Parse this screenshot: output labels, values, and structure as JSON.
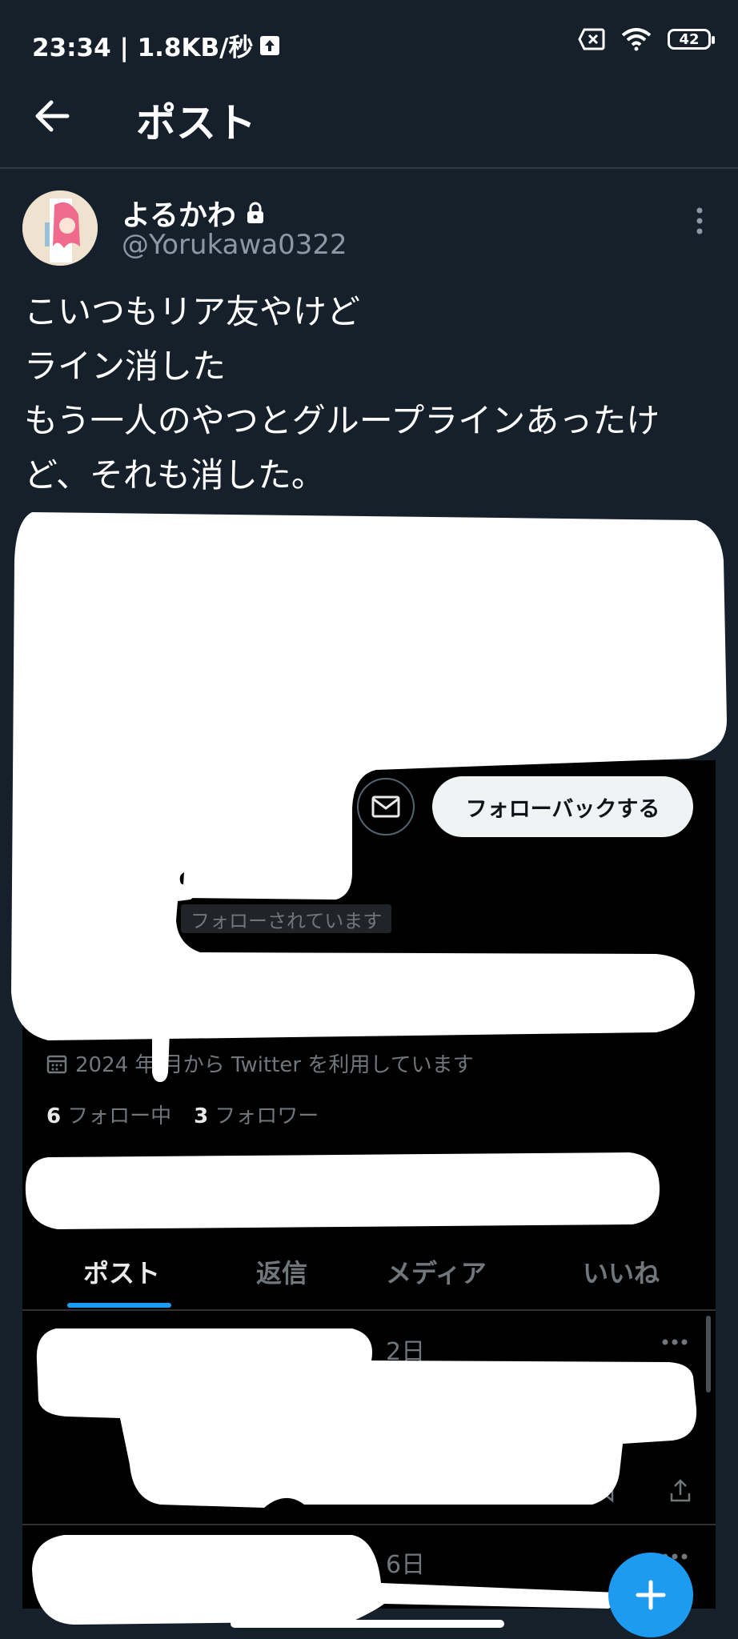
{
  "status_bar": {
    "time_speed": "23:34 | 1.8KB/秒",
    "battery": "42"
  },
  "header": {
    "title": "ポスト"
  },
  "tweet": {
    "display_name": "よるかわ",
    "handle": "@Yorukawa0322",
    "lines": [
      "こいつもリア友やけど",
      "ライン消した",
      "もう一人のやつとグループラインあったけ",
      "ど、それも消した。"
    ]
  },
  "screenshot": {
    "followback_label": "フォローバックする",
    "follows_you": "フォローされています",
    "joined": "2024 年 月から Twitter を利用しています",
    "following_count": "6",
    "following_label": "フォロー中",
    "followers_count": "3",
    "followers_label": "フォロワー",
    "tabs": [
      "ポスト",
      "返信",
      "メディア",
      "いいね"
    ],
    "post1_time": "2日",
    "post2_time": "6日"
  },
  "colors": {
    "background": "#16202b",
    "accent": "#1d9bf0",
    "secondary_text": "#8b98a5"
  }
}
